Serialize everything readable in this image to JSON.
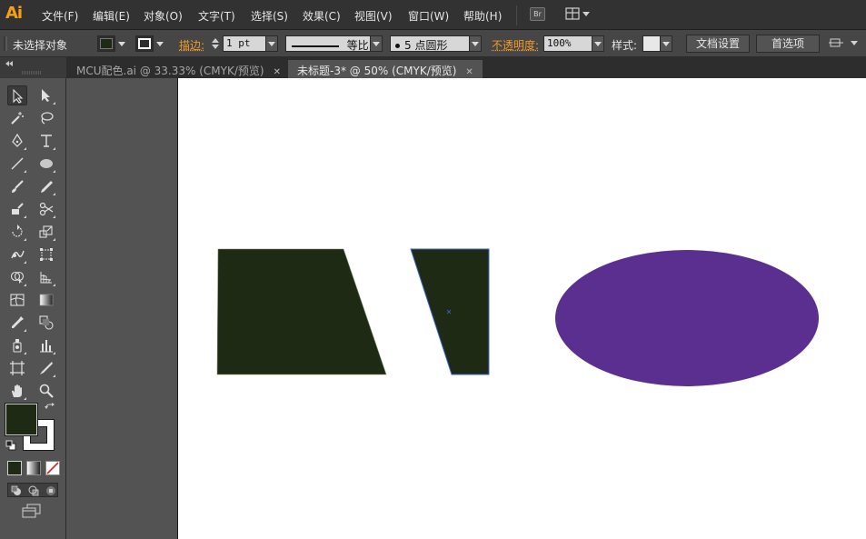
{
  "app": {
    "logo": "Ai"
  },
  "menu": {
    "items": [
      "文件(F)",
      "编辑(E)",
      "对象(O)",
      "文字(T)",
      "选择(S)",
      "效果(C)",
      "视图(V)",
      "窗口(W)",
      "帮助(H)"
    ],
    "bridge_label": "Br"
  },
  "control_bar": {
    "selection_status": "未选择对象",
    "stroke_label": "描边:",
    "stroke_weight": "1 pt",
    "stroke_profile": "等比",
    "brush_label": "5 点圆形",
    "opacity_label": "不透明度:",
    "opacity_value": "100%",
    "style_label": "样式:",
    "doc_setup_button": "文档设置",
    "preferences_button": "首选项",
    "fill_color": "#1e2a14",
    "stroke_color": "#ffffff"
  },
  "tabs": [
    {
      "label": "MCU配色.ai @ 33.33% (CMYK/预览)",
      "close": "✕",
      "active": false
    },
    {
      "label": "未标题-3* @ 50% (CMYK/预览)",
      "close": "✕",
      "active": true
    }
  ],
  "tools_panel": {
    "fill_color": "#1e2a14",
    "stroke_color": "#ffffff",
    "tools": [
      "selection-tool",
      "direct-selection-tool",
      "magic-wand-tool",
      "lasso-tool",
      "pen-tool",
      "type-tool",
      "line-segment-tool",
      "ellipse-tool",
      "paintbrush-tool",
      "pencil-tool",
      "blob-brush-tool",
      "scissors-tool",
      "rotate-tool",
      "scale-tool",
      "warp-tool",
      "free-transform-tool",
      "shape-builder-tool",
      "perspective-grid-tool",
      "mesh-tool",
      "gradient-tool",
      "eyedropper-tool",
      "blend-tool",
      "symbol-sprayer-tool",
      "column-graph-tool",
      "artboard-tool",
      "slice-tool",
      "hand-tool",
      "zoom-tool"
    ]
  },
  "artwork": {
    "shape_colors": {
      "dark_green": "#1e2a14",
      "purple": "#5b2f90",
      "selection_blue": "#3a66d8"
    }
  }
}
